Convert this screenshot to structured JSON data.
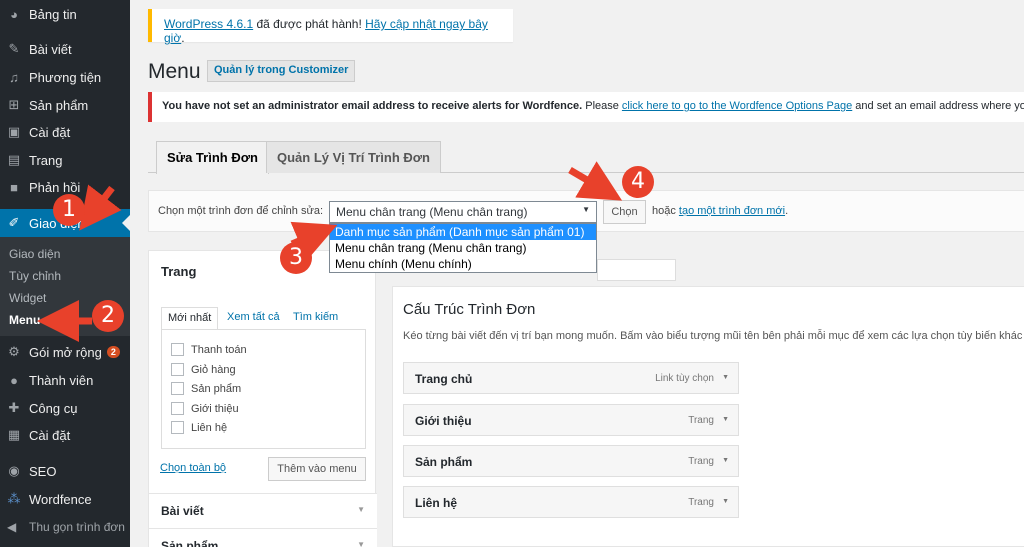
{
  "sidebar": {
    "items": [
      {
        "label": "Bảng tin",
        "icon": "dashboard-icon"
      },
      {
        "label": "Bài viết",
        "icon": "pin-icon"
      },
      {
        "label": "Phương tiện",
        "icon": "media-icon"
      },
      {
        "label": "Sản phẩm",
        "icon": "cart-icon"
      },
      {
        "label": "Cài đặt",
        "icon": "settings-icon"
      },
      {
        "label": "Trang",
        "icon": "page-icon"
      },
      {
        "label": "Phản hồi",
        "icon": "comment-icon"
      },
      {
        "label": "Giao diện",
        "icon": "brush-icon"
      },
      {
        "label": "Gói mở rộng",
        "icon": "plugin-icon",
        "badge": "2"
      },
      {
        "label": "Thành viên",
        "icon": "user-icon"
      },
      {
        "label": "Công cụ",
        "icon": "wrench-icon"
      },
      {
        "label": "Cài đặt",
        "icon": "settings-icon"
      },
      {
        "label": "SEO",
        "icon": "seo-icon"
      },
      {
        "label": "Wordfence",
        "icon": "wordfence-icon"
      }
    ],
    "submenu": [
      "Giao diện",
      "Tùy chỉnh",
      "Widget",
      "Menu"
    ],
    "collapse_label": "Thu gọn trình đơn"
  },
  "update_notice": {
    "link1": "WordPress 4.6.1",
    "text": " đã được phát hành! ",
    "link2": "Hãy cập nhật ngay bây giờ",
    "end": "."
  },
  "page": {
    "title": "Menu",
    "customizer_button": "Quản lý trong Customizer"
  },
  "error_notice": {
    "bold": "You have not set an administrator email address to receive alerts for Wordfence.",
    "text1": " Please ",
    "link": "click here to go to the Wordfence Options Page",
    "text2": " and set an email address where you"
  },
  "tabs": [
    "Sửa Trình Đơn",
    "Quản Lý Vị Trí Trình Đơn"
  ],
  "select_bar": {
    "label": "Chọn một trình đơn để chỉnh sửa:",
    "selected": "Menu chân trang (Menu chân trang)",
    "options": [
      "Danh mục sản phẩm (Danh mục sản phẩm 01)",
      "Menu chân trang (Menu chân trang)",
      "Menu chính (Menu chính)"
    ],
    "button": "Chọn",
    "or_text": "hoặc ",
    "create_link": "tạo một trình đơn mới",
    "create_end": "."
  },
  "left_panel": {
    "heading": "Trang",
    "tabs": [
      "Mới nhất",
      "Xem tất cả",
      "Tìm kiếm"
    ],
    "pages": [
      "Thanh toán",
      "Giỏ hàng",
      "Sản phẩm",
      "Giới thiệu",
      "Liên hệ"
    ],
    "select_all": "Chọn toàn bộ",
    "add_button": "Thêm vào menu",
    "accordions": [
      "Bài viết",
      "Sản phẩm"
    ]
  },
  "structure": {
    "heading": "Cấu Trúc Trình Đơn",
    "description": "Kéo từng bài viết đến vị trí bạn mong muốn. Bấm vào biểu tượng mũi tên bên phải mỗi mục để xem các lựa chọn tùy biến khác",
    "items": [
      {
        "title": "Trang chủ",
        "type": "Link tùy chọn"
      },
      {
        "title": "Giới thiệu",
        "type": "Trang"
      },
      {
        "title": "Sản phẩm",
        "type": "Trang"
      },
      {
        "title": "Liên hệ",
        "type": "Trang"
      }
    ]
  },
  "annotations": [
    "1",
    "2",
    "3",
    "4"
  ],
  "colors": {
    "sidebar_bg": "#23282d",
    "active_bg": "#0073aa",
    "annotation_red": "#e8412b",
    "link": "#0073aa",
    "highlight": "#1e90ff"
  }
}
